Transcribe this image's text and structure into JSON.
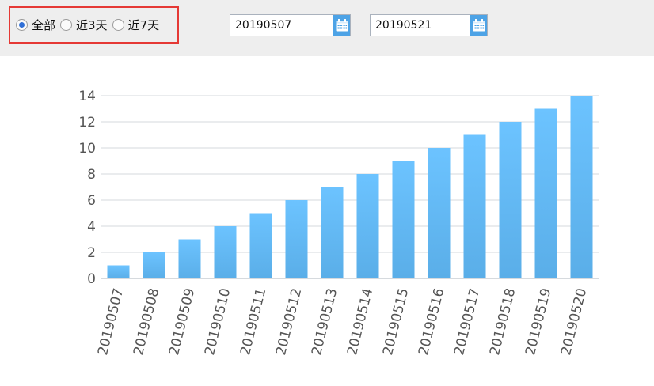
{
  "filter": {
    "options": [
      {
        "label": "全部",
        "checked": true
      },
      {
        "label": "近3天",
        "checked": false
      },
      {
        "label": "近7天",
        "checked": false
      }
    ]
  },
  "date_range": {
    "start": "20190507",
    "end": "20190521",
    "calendar_icon": "calendar-icon"
  },
  "colors": {
    "bar_top": "#6cc3ff",
    "bar_bottom": "#5aaee8",
    "accent": "#4da3e6",
    "highlight_border": "#e53935"
  },
  "chart_data": {
    "type": "bar",
    "categories": [
      "20190507",
      "20190508",
      "20190509",
      "20190510",
      "20190511",
      "20190512",
      "20190513",
      "20190514",
      "20190515",
      "20190516",
      "20190517",
      "20190518",
      "20190519",
      "20190520"
    ],
    "values": [
      1,
      2,
      3,
      4,
      5,
      6,
      7,
      8,
      9,
      10,
      11,
      12,
      13,
      14
    ],
    "ylim": [
      0,
      14
    ],
    "yticks": [
      "0",
      "2",
      "4",
      "6",
      "8",
      "10",
      "12",
      "14"
    ],
    "grid": true,
    "title": "",
    "xlabel": "",
    "ylabel": ""
  }
}
